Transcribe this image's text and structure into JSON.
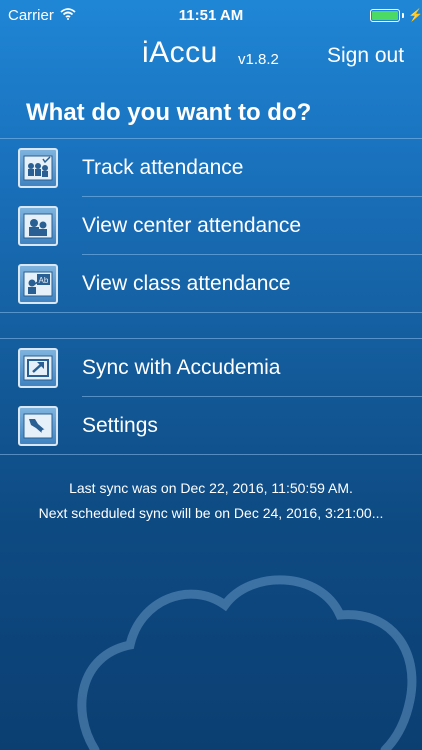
{
  "status_bar": {
    "carrier": "Carrier",
    "time": "11:51 AM",
    "battery_color": "#4cd964"
  },
  "nav": {
    "app_name": "iAccu",
    "version": "v1.8.2",
    "sign_out": "Sign out"
  },
  "heading": "What do you want to do?",
  "menu": {
    "group1": [
      {
        "label": "Track attendance",
        "icon": "track-attendance-icon"
      },
      {
        "label": "View center attendance",
        "icon": "center-attendance-icon"
      },
      {
        "label": "View class attendance",
        "icon": "class-attendance-icon"
      }
    ],
    "group2": [
      {
        "label": "Sync with Accudemia",
        "icon": "sync-icon"
      },
      {
        "label": "Settings",
        "icon": "settings-icon"
      }
    ]
  },
  "sync": {
    "last": "Last sync was on Dec 22, 2016, 11:50:59 AM.",
    "next": "Next scheduled sync will be on Dec 24, 2016, 3:21:00..."
  },
  "theme": {
    "background_top": "#1f86d6",
    "background_bottom": "#0b3f72",
    "icon_fill": "#3f83c1"
  }
}
